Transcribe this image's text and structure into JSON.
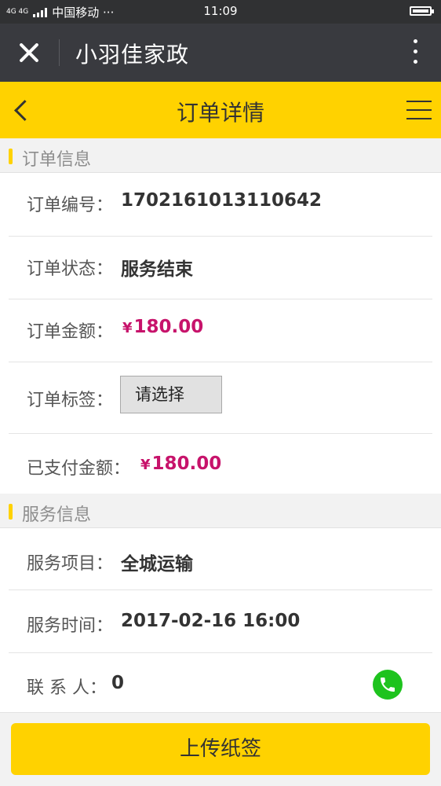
{
  "status_bar": {
    "network": "4G 4G",
    "carrier": "中国移动 ···",
    "time": "11:09",
    "battery_level": 1.0
  },
  "wechat_bar": {
    "title": "小羽佳家政",
    "close_icon": "close-icon",
    "more_icon": "more-vertical-icon"
  },
  "header": {
    "title": "订单详情",
    "back_icon": "chevron-left-icon",
    "menu_icon": "hamburger-icon"
  },
  "order_info": {
    "section_title": "订单信息",
    "order_no_label": "订单编号：",
    "order_no": "1702161013110642",
    "status_label": "订单状态：",
    "status": "服务结束",
    "amount_label": "订单金额：",
    "currency": "¥",
    "amount": "180.00",
    "tag_label": "订单标签：",
    "tag_placeholder": "请选择",
    "paid_label": "已支付金额：",
    "paid_amount": "180.00"
  },
  "service_info": {
    "section_title": "服务信息",
    "item_label": "服务项目：",
    "item": "全城运输",
    "time_label": "服务时间：",
    "time": "2017-02-16 16:00",
    "contact_label": "联 系 人：",
    "contact": "0",
    "phone_icon": "phone-icon"
  },
  "bottom": {
    "upload_label": "上传纸签"
  },
  "colors": {
    "accent": "#ffd200",
    "price": "#c7136b",
    "phone": "#1ec31e",
    "wechat_bar": "#393a3f"
  }
}
